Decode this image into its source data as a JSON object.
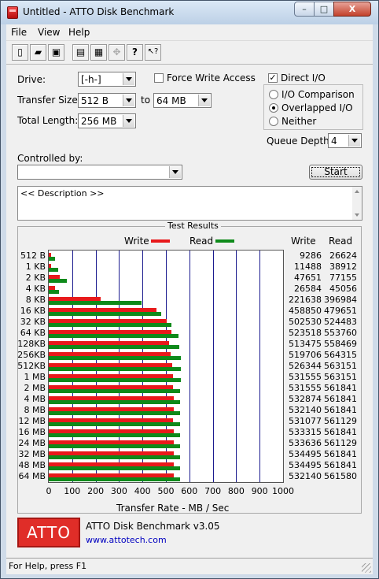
{
  "window": {
    "title": "Untitled - ATTO Disk Benchmark",
    "min": "–",
    "max": "□",
    "close": "X"
  },
  "menu": [
    "File",
    "View",
    "Help"
  ],
  "toolbar": [
    {
      "icon": "new-document-icon",
      "glyph": "▯"
    },
    {
      "icon": "open-folder-icon",
      "glyph": "▰"
    },
    {
      "icon": "save-icon",
      "glyph": "▣"
    },
    {
      "icon": "print-icon",
      "glyph": "▤"
    },
    {
      "icon": "print-preview-icon",
      "glyph": "▦"
    },
    {
      "icon": "move-icon",
      "glyph": "✥"
    },
    {
      "icon": "help-icon",
      "glyph": "?"
    },
    {
      "icon": "context-help-icon",
      "glyph": "↖?"
    }
  ],
  "form": {
    "drive_label": "Drive:",
    "drive_value": "[-h-]",
    "force_write_label": "Force Write Access",
    "force_write_checked": false,
    "direct_io_label": "Direct I/O",
    "direct_io_checked": true,
    "transfer_size_label": "Transfer Size:",
    "transfer_from": "512 B",
    "to_label": "to",
    "transfer_to": "64 MB",
    "total_length_label": "Total Length:",
    "total_length": "256 MB",
    "io_comparison_label": "I/O Comparison",
    "overlapped_io_label": "Overlapped I/O",
    "neither_label": "Neither",
    "io_mode_selected": "Overlapped I/O",
    "queue_depth_label": "Queue Depth:",
    "queue_depth": "4",
    "controlled_by_label": "Controlled by:",
    "controlled_by_value": "",
    "start_label": "Start",
    "description_text": "<< Description >>"
  },
  "results": {
    "title": "Test Results",
    "write_legend": "Write",
    "read_legend": "Read",
    "write_header": "Write",
    "read_header": "Read",
    "xlabel": "Transfer Rate - MB / Sec"
  },
  "colors": {
    "write": "#e8191b",
    "read": "#0e8a1a",
    "grid": "#1b1b8f"
  },
  "chart_data": {
    "type": "bar",
    "orientation": "horizontal",
    "categories": [
      "512 B",
      "1 KB",
      "2 KB",
      "4 KB",
      "8 KB",
      "16 KB",
      "32 KB",
      "64 KB",
      "128KB",
      "256KB",
      "512KB",
      "1 MB",
      "2 MB",
      "4 MB",
      "8 MB",
      "12 MB",
      "16 MB",
      "24 MB",
      "32 MB",
      "48 MB",
      "64 MB"
    ],
    "series": [
      {
        "name": "Write",
        "values": [
          9286,
          11488,
          47651,
          26584,
          221638,
          458850,
          502530,
          523518,
          513475,
          519706,
          526344,
          531555,
          531555,
          532874,
          532140,
          531077,
          533315,
          533636,
          534495,
          534495,
          532140
        ]
      },
      {
        "name": "Read",
        "values": [
          26624,
          38912,
          77155,
          45056,
          396984,
          479651,
          524483,
          553760,
          558469,
          564315,
          563151,
          563151,
          561841,
          561841,
          561841,
          561129,
          561841,
          561129,
          561841,
          561841,
          561580
        ]
      }
    ],
    "xticks": [
      "0",
      "100",
      "200",
      "300",
      "400",
      "500",
      "600",
      "700",
      "800",
      "900",
      "1000"
    ],
    "xlim": [
      0,
      1000
    ],
    "xlabel": "Transfer Rate - MB / Sec",
    "grid": true,
    "legend": "top"
  },
  "footer": {
    "logo": "ATTO",
    "product": "ATTO Disk Benchmark v3.05",
    "url": "www.attotech.com"
  },
  "status": "For Help, press F1"
}
